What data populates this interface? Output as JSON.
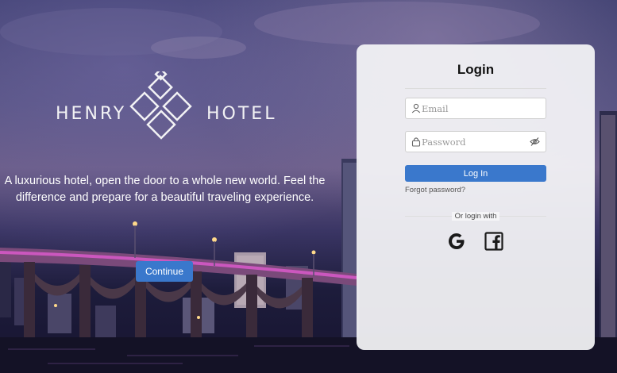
{
  "brand": {
    "left_word": "HENRY",
    "right_word": "HOTEL"
  },
  "hero": {
    "tagline": "A luxurious hotel, open the door to a whole new world. Feel the difference and prepare for a beautiful traveling experience.",
    "continue_label": "Continue"
  },
  "login": {
    "title": "Login",
    "email_placeholder": "Email",
    "password_placeholder": "Password",
    "submit_label": "Log In",
    "forgot_label": "Forgot password?",
    "alt_login_label": "Or login with",
    "social": [
      {
        "icon": "google-icon"
      },
      {
        "icon": "facebook-icon"
      }
    ]
  },
  "colors": {
    "primary": "#3a78cc",
    "card_bg": "#f5f5f7",
    "title_text": "#111111"
  }
}
